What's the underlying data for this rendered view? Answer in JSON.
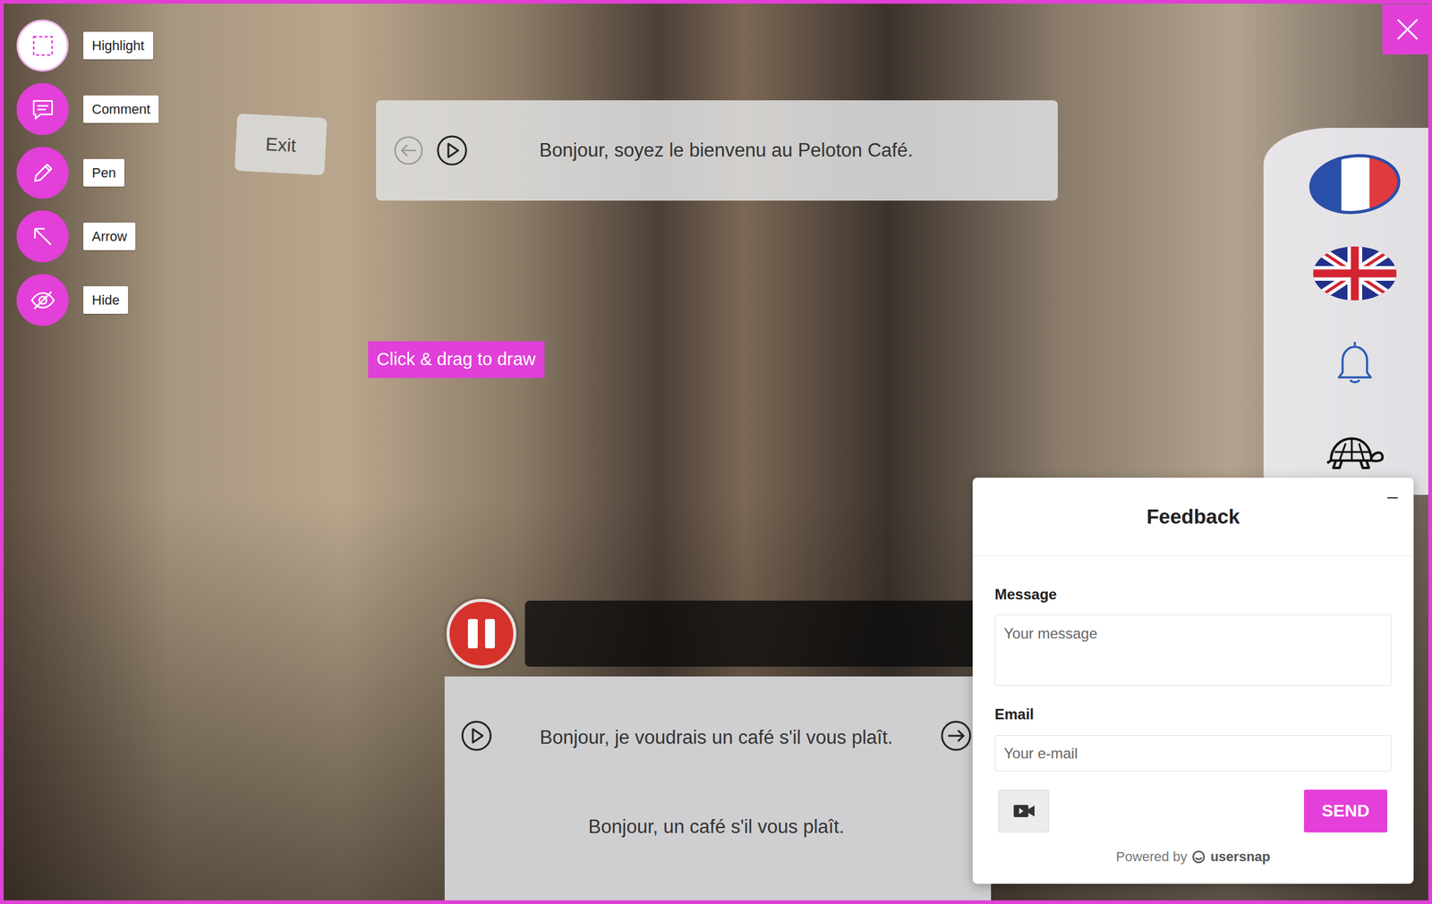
{
  "toolbar": {
    "tools": [
      {
        "label": "Highlight",
        "selected": true
      },
      {
        "label": "Comment",
        "selected": false
      },
      {
        "label": "Pen",
        "selected": false
      },
      {
        "label": "Arrow",
        "selected": false
      },
      {
        "label": "Hide",
        "selected": false
      }
    ]
  },
  "exit_button": {
    "label": "Exit"
  },
  "prompt": {
    "text": "Bonjour, soyez le bienvenu au Peloton Café.",
    "back_disabled": true
  },
  "hint": {
    "text": "Click & drag to draw"
  },
  "video": {
    "playing": true
  },
  "options": [
    {
      "text": "Bonjour, je voudrais un café s'il vous plaît.",
      "kind": "controls"
    },
    {
      "text": "Bonjour, un café s'il vous plaît.",
      "kind": "plain"
    }
  ],
  "feedback": {
    "title": "Feedback",
    "minimize": "–",
    "message_label": "Message",
    "message_placeholder": "Your message",
    "email_label": "Email",
    "email_placeholder": "Your e-mail",
    "send": "SEND",
    "powered_by": "Powered by",
    "brand": "usersnap"
  }
}
